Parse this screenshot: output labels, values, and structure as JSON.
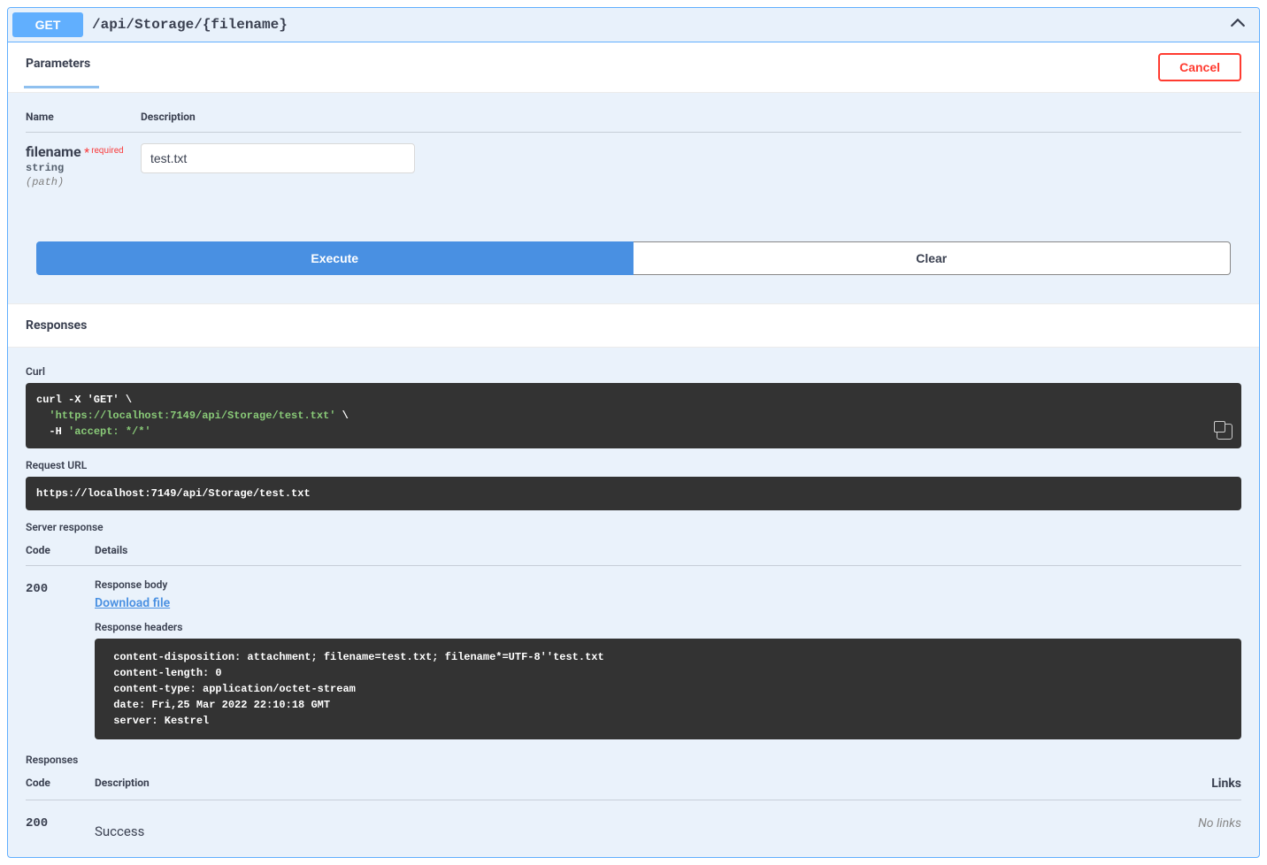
{
  "opblock": {
    "method": "GET",
    "path": "/api/Storage/{filename}"
  },
  "sections": {
    "parameters_title": "Parameters",
    "cancel_label": "Cancel",
    "responses_title": "Responses"
  },
  "param_table": {
    "head_name": "Name",
    "head_desc": "Description"
  },
  "parameter": {
    "name": "filename",
    "required_label": "required",
    "type": "string",
    "in": "(path)",
    "value": "test.txt"
  },
  "buttons": {
    "execute": "Execute",
    "clear": "Clear"
  },
  "response": {
    "curl_label": "Curl",
    "request_url_label": "Request URL",
    "request_url": "https://localhost:7149/api/Storage/test.txt",
    "server_response_label": "Server response",
    "col_code": "Code",
    "col_details": "Details",
    "code": "200",
    "response_body_label": "Response body",
    "download_link": "Download file",
    "response_headers_label": "Response headers",
    "headers_text": " content-disposition: attachment; filename=test.txt; filename*=UTF-8''test.txt \n content-length: 0 \n content-type: application/octet-stream \n date: Fri,25 Mar 2022 22:10:18 GMT \n server: Kestrel ",
    "curl_l1": "curl -X 'GET' \\",
    "curl_l2": "'https://localhost:7149/api/Storage/test.txt'",
    "curl_l2b": " \\",
    "curl_l3a": "  -H ",
    "curl_l3b": "'accept: */*'"
  },
  "responses_doc": {
    "label": "Responses",
    "col_code": "Code",
    "col_desc": "Description",
    "col_links": "Links",
    "code": "200",
    "desc": "Success",
    "links": "No links"
  }
}
